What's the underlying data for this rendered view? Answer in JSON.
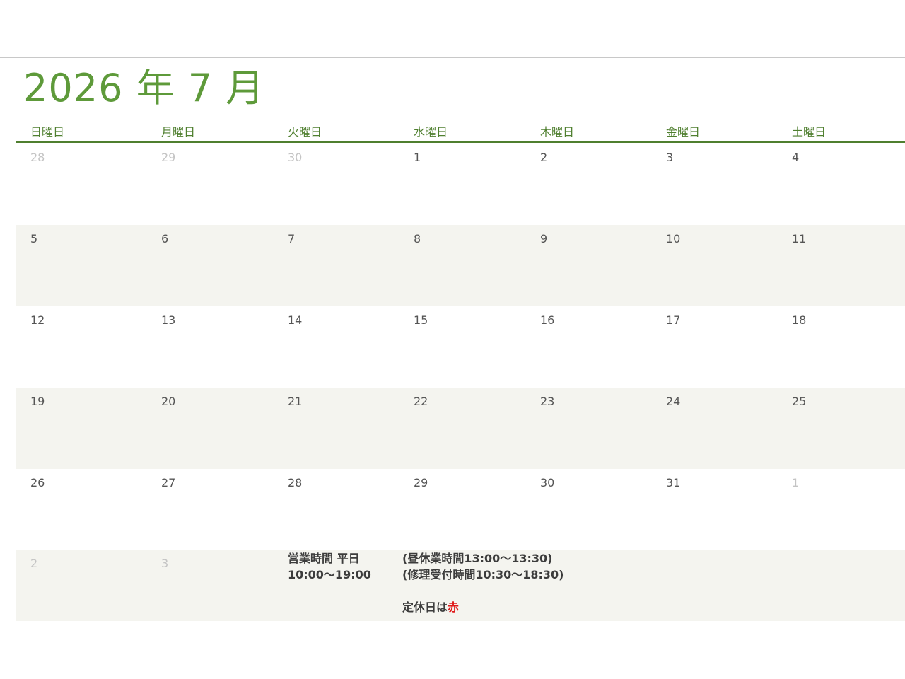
{
  "calendar": {
    "title": "2026 年 7 月",
    "weekdays": [
      "日曜日",
      "月曜日",
      "火曜日",
      "水曜日",
      "木曜日",
      "金曜日",
      "土曜日"
    ],
    "weeks": [
      [
        {
          "d": "28",
          "o": true
        },
        {
          "d": "29",
          "o": true
        },
        {
          "d": "30",
          "o": true
        },
        {
          "d": "1",
          "o": false
        },
        {
          "d": "2",
          "o": false
        },
        {
          "d": "3",
          "o": false
        },
        {
          "d": "4",
          "o": false
        }
      ],
      [
        {
          "d": "5",
          "o": false
        },
        {
          "d": "6",
          "o": false
        },
        {
          "d": "7",
          "o": false
        },
        {
          "d": "8",
          "o": false
        },
        {
          "d": "9",
          "o": false
        },
        {
          "d": "10",
          "o": false
        },
        {
          "d": "11",
          "o": false
        }
      ],
      [
        {
          "d": "12",
          "o": false
        },
        {
          "d": "13",
          "o": false
        },
        {
          "d": "14",
          "o": false
        },
        {
          "d": "15",
          "o": false
        },
        {
          "d": "16",
          "o": false
        },
        {
          "d": "17",
          "o": false
        },
        {
          "d": "18",
          "o": false
        }
      ],
      [
        {
          "d": "19",
          "o": false
        },
        {
          "d": "20",
          "o": false
        },
        {
          "d": "21",
          "o": false
        },
        {
          "d": "22",
          "o": false
        },
        {
          "d": "23",
          "o": false
        },
        {
          "d": "24",
          "o": false
        },
        {
          "d": "25",
          "o": false
        }
      ],
      [
        {
          "d": "26",
          "o": false
        },
        {
          "d": "27",
          "o": false
        },
        {
          "d": "28",
          "o": false
        },
        {
          "d": "29",
          "o": false
        },
        {
          "d": "30",
          "o": false
        },
        {
          "d": "31",
          "o": false
        },
        {
          "d": "1",
          "o": true
        }
      ],
      [
        {
          "d": "2",
          "o": true
        },
        {
          "d": "3",
          "o": true
        }
      ]
    ]
  },
  "notes": {
    "hours_line1": "営業時間 平日",
    "hours_line2": "10:00～19:00",
    "lunch": "(昼休業時間13:00～13:30)",
    "repair": "(修理受付時間10:30～18:30)",
    "holiday_prefix": "定休日は",
    "holiday_color_word": "赤"
  },
  "colors": {
    "title": "#5e9a3a",
    "header": "#4f7f2f",
    "shaded_row": "#f4f4ef",
    "holiday_red": "#e01818"
  }
}
